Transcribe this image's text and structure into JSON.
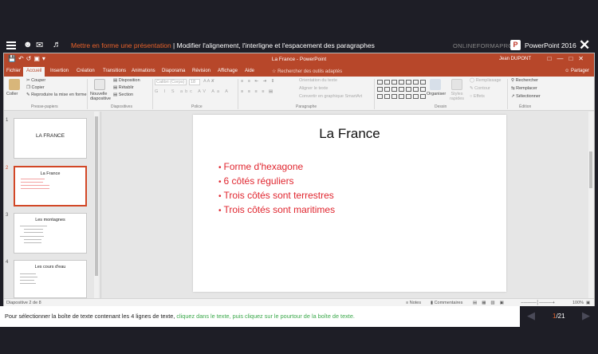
{
  "tutorial": {
    "breadcrumb_section": "Mettre en forme une présentation",
    "breadcrumb_sep": " | ",
    "breadcrumb_lesson": "Modifier l'alignement, l'interligne et l'espacement des paragraphes",
    "brand": "ONLINEFORMAPRO",
    "product": "PowerPoint 2016",
    "instruction_plain": "Pour sélectionner la boîte de texte contenant les 4 lignes de texte, ",
    "instruction_action": "cliquez dans le texte, puis cliquez sur le pourtour de la boîte de texte.",
    "page_current": "1",
    "page_total": "/21"
  },
  "window": {
    "title": "La France  -  PowerPoint",
    "user": "Jean DUPONT"
  },
  "tabs": [
    "Fichier",
    "Accueil",
    "Insertion",
    "Création",
    "Transitions",
    "Animations",
    "Diaporama",
    "Révision",
    "Affichage",
    "Aide"
  ],
  "search_placeholder": "Rechercher des outils adaptés",
  "share": "Partager",
  "ribbon": {
    "clipboard": {
      "paste": "Coller",
      "cut": "Couper",
      "copy": "Copier",
      "format_painter": "Reproduire la mise en forme",
      "label": "Presse-papiers"
    },
    "slides": {
      "new_slide": "Nouvelle diapositive",
      "layout": "Disposition",
      "reset": "Rétablir",
      "section": "Section",
      "label": "Diapositives"
    },
    "font": {
      "name": "Calibri (Corps)",
      "size": "18",
      "label": "Police"
    },
    "paragraph": {
      "text_direction": "Orientation du texte",
      "align_text": "Aligner le texte",
      "smartart": "Convertir en graphique SmartArt",
      "label": "Paragraphe"
    },
    "drawing": {
      "arrange": "Organiser",
      "quick_styles": "Styles rapides",
      "fill": "Remplissage",
      "outline": "Contour",
      "effects": "Effets",
      "label": "Dessin"
    },
    "editing": {
      "find": "Rechercher",
      "replace": "Remplacer",
      "select": "Sélectionner",
      "label": "Édition"
    }
  },
  "thumbnails": [
    {
      "num": "1",
      "title": "LA FRANCE"
    },
    {
      "num": "2",
      "title": "La France"
    },
    {
      "num": "3",
      "title": "Les montagnes"
    },
    {
      "num": "4",
      "title": "Les cours d'eau"
    }
  ],
  "slide": {
    "title": "La France",
    "bullets": [
      "Forme d'hexagone",
      "6 côtés réguliers",
      "Trois côtés sont terrestres",
      "Trois côtés sont maritimes"
    ]
  },
  "status": {
    "slide_counter": "Diapositive 2 de 8",
    "notes": "Notes",
    "comments": "Commentaires",
    "zoom": "100%"
  },
  "colors": {
    "accent": "#b7472a",
    "bullet_text": "#e0262f",
    "instruction_action": "#3aa84a",
    "breadcrumb_section": "#e8622a"
  }
}
